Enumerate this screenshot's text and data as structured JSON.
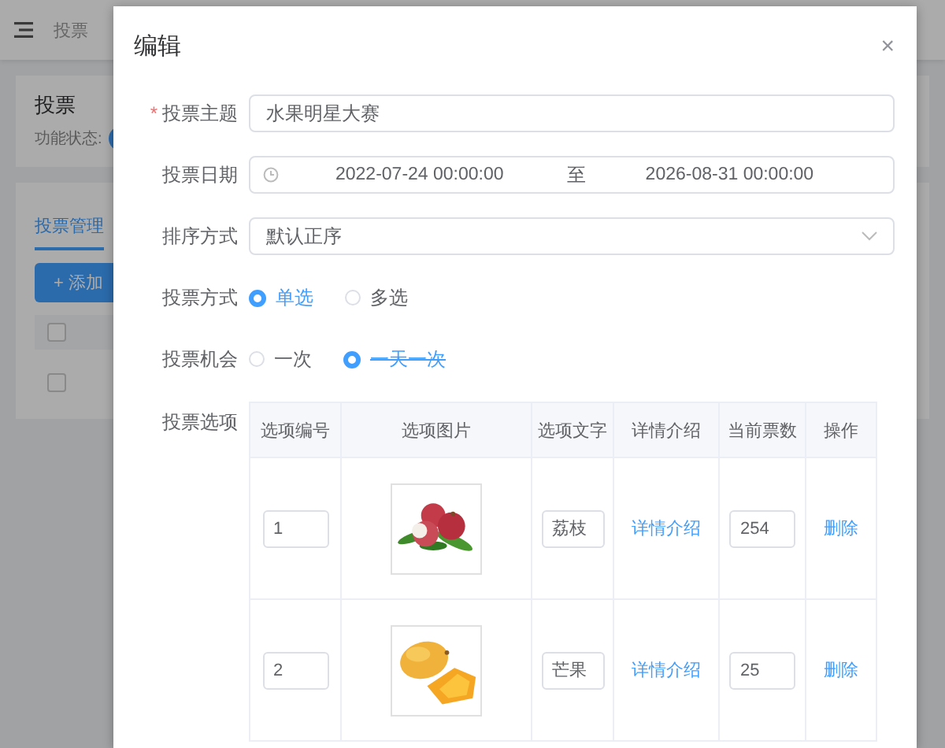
{
  "background": {
    "header": {
      "title": "投票"
    },
    "card": {
      "title": "投票",
      "status_label": "功能状态:",
      "switch_on": true
    },
    "tabs": [
      {
        "label": "投票管理",
        "selected": true
      }
    ],
    "add_button": {
      "icon": "+",
      "label": "添加"
    },
    "table": {
      "header_checked": false,
      "rows": [
        {
          "checked": false
        }
      ]
    }
  },
  "dialog": {
    "title": "编辑",
    "close": "×",
    "fields": [
      {
        "kind": "text",
        "label": "投票主题",
        "required_mark": "*",
        "value": "水果明星大赛"
      },
      {
        "kind": "daterange",
        "label": "投票日期",
        "start": "2022-07-24 00:00:00",
        "separator": "至",
        "end": "2026-08-31 00:00:00"
      },
      {
        "kind": "select",
        "label": "排序方式",
        "value": "默认正序"
      },
      {
        "kind": "radio",
        "label": "投票方式",
        "options": [
          {
            "label": "单选",
            "selected": true,
            "struck": false
          },
          {
            "label": "多选",
            "selected": false,
            "struck": false
          }
        ]
      },
      {
        "kind": "radio",
        "label": "投票机会",
        "options": [
          {
            "label": "一次",
            "selected": false,
            "struck": false
          },
          {
            "label": "一天一次",
            "selected": true,
            "struck": true
          }
        ]
      },
      {
        "kind": "table",
        "label": "投票选项",
        "columns": [
          "选项编号",
          "选项图片",
          "选项文字",
          "详情介绍",
          "当前票数",
          "操作"
        ],
        "rows": [
          {
            "number": "1",
            "text": "荔枝",
            "detail": "详情介绍",
            "votes": "254",
            "action": "删除"
          },
          {
            "number": "2",
            "text": "芒果",
            "detail": "详情介绍",
            "votes": "25",
            "action": "删除"
          }
        ]
      }
    ]
  }
}
